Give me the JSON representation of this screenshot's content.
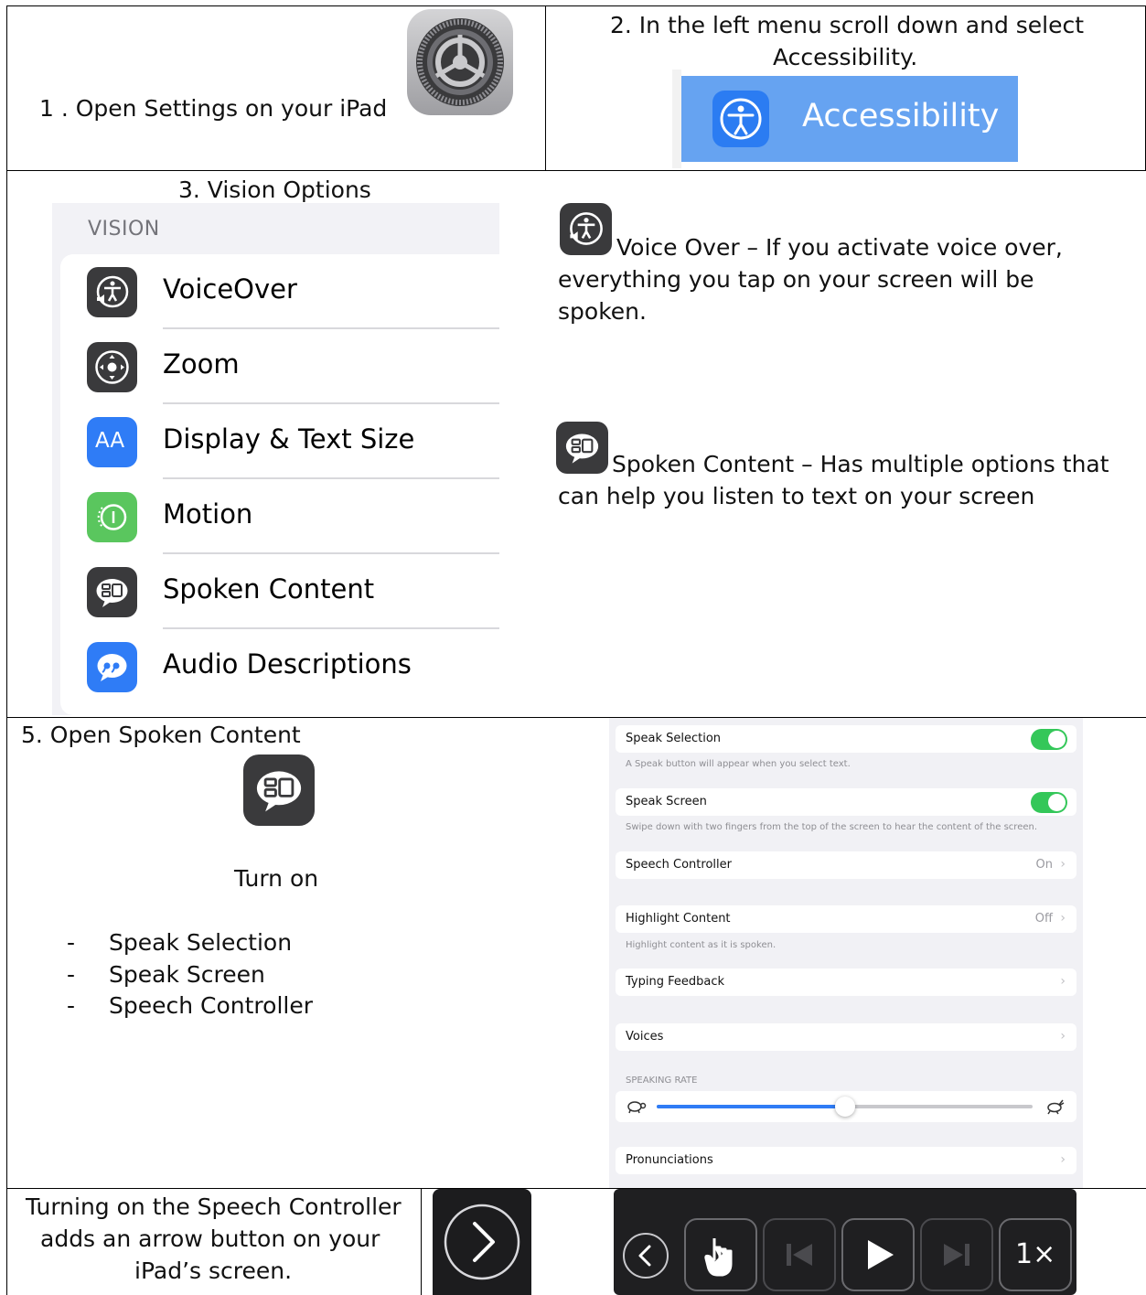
{
  "step1": {
    "text": "1 . Open Settings on your iPad"
  },
  "step2": {
    "line1": "2. In the left menu scroll down and select",
    "line2": "Accessibility.",
    "banner_label": "Accessibility"
  },
  "step3": {
    "title": "3. Vision Options",
    "header": "VISION",
    "items": [
      {
        "label": "VoiceOver",
        "icon": "voiceover-icon",
        "color": "#3a3a3c"
      },
      {
        "label": "Zoom",
        "icon": "zoom-icon",
        "color": "#3a3a3c"
      },
      {
        "label": "Display & Text Size",
        "icon": "text-size-icon",
        "color": "#2f7cf6"
      },
      {
        "label": "Motion",
        "icon": "motion-icon",
        "color": "#5ac65e"
      },
      {
        "label": "Spoken Content",
        "icon": "spoken-content-icon",
        "color": "#3a3a3c"
      },
      {
        "label": "Audio Descriptions",
        "icon": "audio-descriptions-icon",
        "color": "#2f7cf6"
      }
    ],
    "text_size_glyph": "AA"
  },
  "voiceover_desc": {
    "line1": "Voice Over – If you activate voice over,",
    "line2": "everything you tap on your screen will be",
    "line3": "spoken."
  },
  "spoken_desc": {
    "line1": "Spoken Content – Has multiple options that",
    "line2": "can help you listen to text on your screen"
  },
  "step5": {
    "title": "5. Open Spoken Content",
    "turn_on": "Turn on",
    "bullets": [
      "Speak Selection",
      "Speak Screen",
      "Speech Controller"
    ],
    "bullet_mark": "-"
  },
  "spoken_settings": {
    "speak_selection": {
      "label": "Speak Selection",
      "on": true,
      "note": "A Speak button will appear when you select text."
    },
    "speak_screen": {
      "label": "Speak Screen",
      "on": true,
      "note": "Swipe down with two fingers from the top of the screen to hear the content of the screen."
    },
    "speech_controller": {
      "label": "Speech Controller",
      "value": "On"
    },
    "highlight_content": {
      "label": "Highlight Content",
      "value": "Off",
      "note": "Highlight content as it is spoken."
    },
    "typing_feedback": {
      "label": "Typing Feedback"
    },
    "voices": {
      "label": "Voices"
    },
    "speaking_rate": {
      "header": "SPEAKING RATE",
      "level": 0.5
    },
    "pronunciations": {
      "label": "Pronunciations"
    },
    "chevron": "›"
  },
  "controller": {
    "text_line1": "Turning on the Speech Controller",
    "text_line2": "adds an arrow button on your",
    "text_line3": "iPad’s screen.",
    "speed_label": "1×"
  },
  "colors": {
    "accessibility_blue": "#66a3f1",
    "toggle_green": "#34c759",
    "slider_blue": "#2f7cf6"
  }
}
